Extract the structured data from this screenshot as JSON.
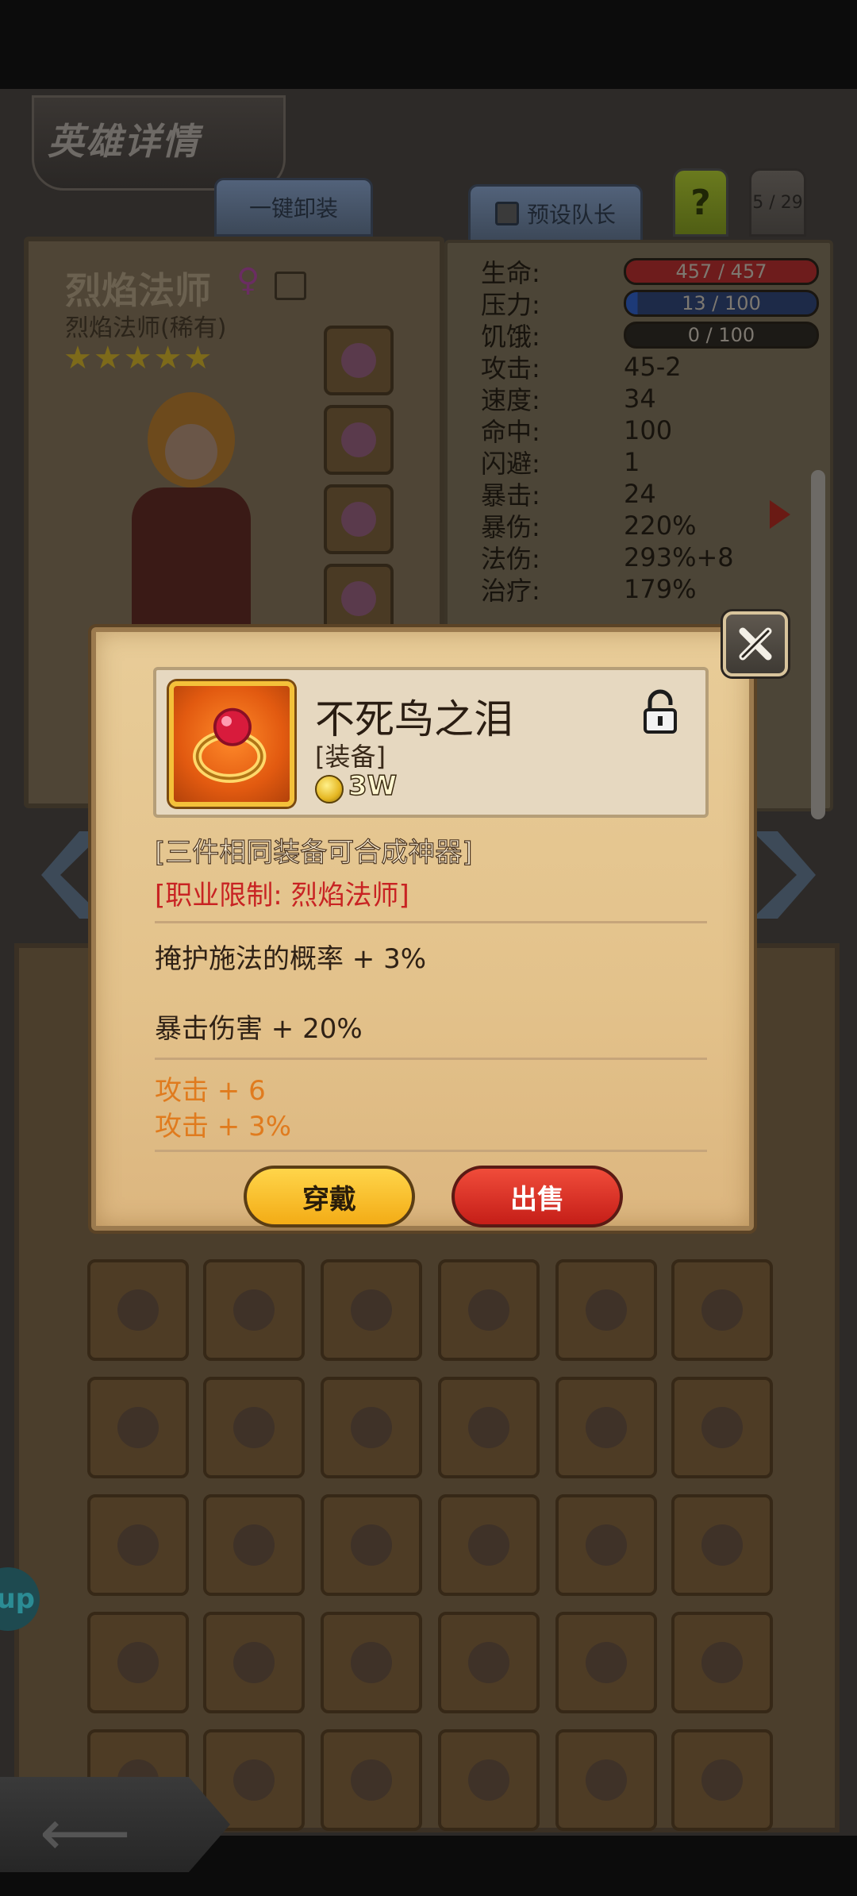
{
  "header": {
    "title": "英雄详情",
    "unequip_all": "一键卸装",
    "preset_leader": "预设队长",
    "help": "?",
    "hero_count": "5 / 29"
  },
  "hero": {
    "name": "烈焰法师",
    "subtitle": "烈焰法师(稀有)",
    "gender_symbol": "♀",
    "stars": "★★★★★",
    "star_rating": 5
  },
  "stats": [
    {
      "label": "生命:",
      "value": "457 / 457",
      "kind": "bar",
      "color": "#6e1c1c"
    },
    {
      "label": "压力:",
      "value": "13 / 100",
      "kind": "bar",
      "color": "#1d2a48"
    },
    {
      "label": "饥饿:",
      "value": "0 / 100",
      "kind": "bar",
      "color": "#1c1a16"
    },
    {
      "label": "攻击:",
      "value": "45-2",
      "kind": "text"
    },
    {
      "label": "速度:",
      "value": "34",
      "kind": "text"
    },
    {
      "label": "命中:",
      "value": "100",
      "kind": "text"
    },
    {
      "label": "闪避:",
      "value": "1",
      "kind": "text"
    },
    {
      "label": "暴击:",
      "value": "24",
      "kind": "text"
    },
    {
      "label": "暴伤:",
      "value": "220%",
      "kind": "text"
    },
    {
      "label": "法伤:",
      "value": "293%+8",
      "kind": "text"
    },
    {
      "label": "治疗:",
      "value": "179%",
      "kind": "text"
    }
  ],
  "item": {
    "name": "不死鸟之泪",
    "type": "[装备]",
    "price": "3W",
    "merge_hint": "[三件相同装备可合成神器]",
    "class_restriction": "[职业限制: 烈焰法师]",
    "attributes": [
      "掩护施法的概率 + 3%",
      "暴击伤害 + 20%"
    ],
    "bonuses": [
      "攻击 + 6",
      "攻击 + 3%"
    ]
  },
  "actions": {
    "wear": "穿戴",
    "sell": "出售"
  },
  "side_badge": "up",
  "colors": {
    "modal_bg": "#e3c28b",
    "wear_button": "#f3ac16",
    "sell_button": "#c51e18",
    "restriction_text": "#c82323",
    "bonus_text": "#e07b1e"
  },
  "icons": [
    "close-x-icon",
    "lock-icon",
    "coin-icon",
    "ring-icon",
    "back-arrow-icon"
  ]
}
